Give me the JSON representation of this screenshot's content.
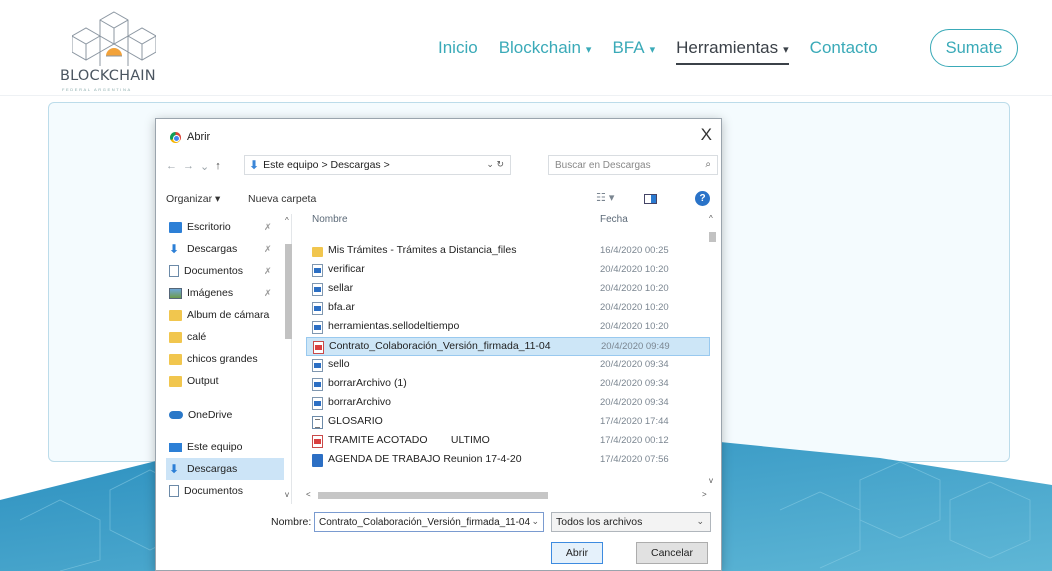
{
  "site": {
    "logo_text": "BLOCKCHAIN",
    "logo_sub": "FEDERAL ARGENTINA",
    "nav": [
      {
        "label": "Inicio",
        "caret": ""
      },
      {
        "label": "Blockchain",
        "caret": "▾"
      },
      {
        "label": "BFA",
        "caret": "▾"
      },
      {
        "label": "Herramientas",
        "caret": "▾"
      },
      {
        "label": "Contacto",
        "caret": ""
      }
    ],
    "join_label": "Sumate",
    "accent": "#3aaab8"
  },
  "dialog": {
    "title": "Abrir",
    "close": "X",
    "nav_back": "←",
    "nav_forward": "→",
    "nav_recent": "⌄",
    "nav_up": "↑",
    "address": "Este equipo  >  Descargas  >",
    "address_controls": "⌄  ↻",
    "search_placeholder": "Buscar en Descargas",
    "search_glyph": "⌕",
    "organize": "Organizar ▾",
    "new_folder": "Nueva carpeta",
    "view_glyph": "☷ ▾",
    "help_glyph": "?",
    "pin_glyph": "✗",
    "scroll_up_glyph": "^",
    "scroll_down_glyph": "v",
    "scroll_left_glyph": "<",
    "scroll_right_glyph": ">",
    "dropdown_glyph": "⌄",
    "sidebar": [
      {
        "label": "Escritorio",
        "icon": "desktop-icon",
        "pinned": true
      },
      {
        "label": "Descargas",
        "icon": "downloads-icon",
        "pinned": true
      },
      {
        "label": "Documentos",
        "icon": "documents-icon",
        "pinned": true
      },
      {
        "label": "Imágenes",
        "icon": "pictures-icon",
        "pinned": true
      },
      {
        "label": "Album de cámara",
        "icon": "folder-icon",
        "pinned": false
      },
      {
        "label": "calé",
        "icon": "folder-icon",
        "pinned": false
      },
      {
        "label": "chicos grandes",
        "icon": "folder-icon",
        "pinned": false
      },
      {
        "label": "Output",
        "icon": "folder-icon",
        "pinned": false
      },
      {
        "label": "OneDrive",
        "icon": "onedrive-icon",
        "pinned": false
      },
      {
        "label": "Este equipo",
        "icon": "computer-icon",
        "pinned": false
      },
      {
        "label": "Descargas",
        "icon": "downloads-icon",
        "pinned": false,
        "selected": true
      },
      {
        "label": "Documentos",
        "icon": "documents-icon",
        "pinned": false
      }
    ],
    "columns": {
      "name": "Nombre",
      "date": "Fecha"
    },
    "files": [
      {
        "name": "Mis Trámites - Trámites a Distancia_files",
        "date": "16/4/2020 00:25",
        "type": "folder"
      },
      {
        "name": "verificar",
        "date": "20/4/2020 10:20",
        "type": "html"
      },
      {
        "name": "sellar",
        "date": "20/4/2020 10:20",
        "type": "html"
      },
      {
        "name": "bfa.ar",
        "date": "20/4/2020 10:20",
        "type": "html"
      },
      {
        "name": "herramientas.sellodeltiempo",
        "date": "20/4/2020 10:20",
        "type": "html"
      },
      {
        "name": "Contrato_Colaboración_Versión_firmada_11-04",
        "date": "20/4/2020 09:49",
        "type": "pdf",
        "selected": true
      },
      {
        "name": "sello",
        "date": "20/4/2020 09:34",
        "type": "html"
      },
      {
        "name": "borrarArchivo (1)",
        "date": "20/4/2020 09:34",
        "type": "html"
      },
      {
        "name": "borrarArchivo",
        "date": "20/4/2020 09:34",
        "type": "html"
      },
      {
        "name": "GLOSARIO",
        "date": "17/4/2020 17:44",
        "type": "doc"
      },
      {
        "name": "TRAMITE ACOTADO        ULTIMO",
        "date": "17/4/2020 00:12",
        "type": "pdf"
      },
      {
        "name": "AGENDA DE TRABAJO Reunion 17-4-20",
        "date": "17/4/2020 07:56",
        "type": "ppt"
      }
    ],
    "filename_label": "Nombre:",
    "filename_value": "Contrato_Colaboración_Versión_firmada_11-04",
    "filetype_value": "Todos los archivos",
    "open_label": "Abrir",
    "cancel_label": "Cancelar"
  }
}
